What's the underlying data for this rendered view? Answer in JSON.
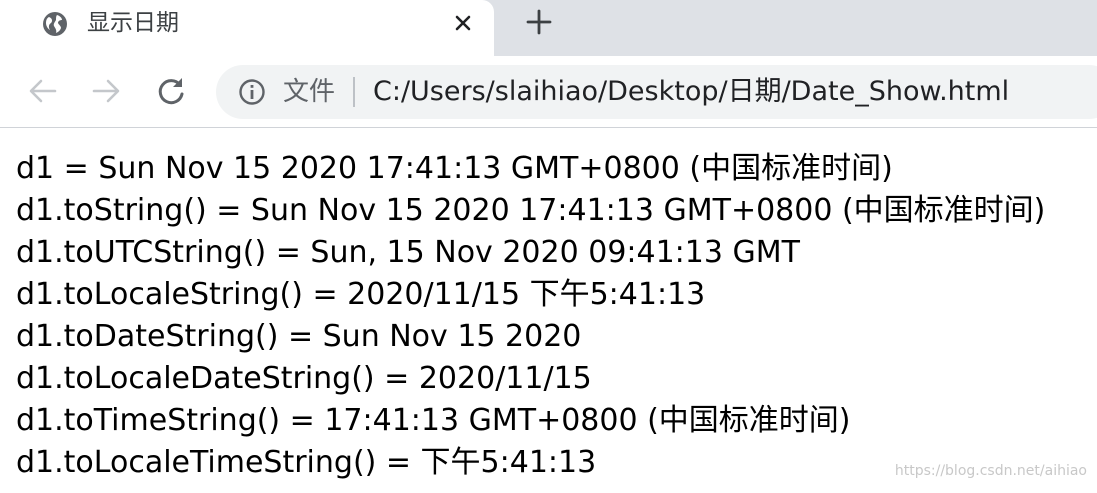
{
  "tab": {
    "title": "显示日期"
  },
  "toolbar": {
    "scheme_label": "文件",
    "url": "C:/Users/slaihiao/Desktop/日期/Date_Show.html"
  },
  "content": {
    "lines": [
      "d1 = Sun Nov 15 2020 17:41:13 GMT+0800 (中国标准时间)",
      "d1.toString() = Sun Nov 15 2020 17:41:13 GMT+0800 (中国标准时间)",
      "d1.toUTCString() = Sun, 15 Nov 2020 09:41:13 GMT",
      "d1.toLocaleString() = 2020/11/15 下午5:41:13",
      "d1.toDateString() = Sun Nov 15 2020",
      "d1.toLocaleDateString() = 2020/11/15",
      "d1.toTimeString() = 17:41:13 GMT+0800 (中国标准时间)",
      "d1.toLocaleTimeString() = 下午5:41:13"
    ]
  },
  "watermark": "https://blog.csdn.net/aihiao",
  "icons": {
    "favicon": "globe-icon",
    "close": "close-icon",
    "new_tab": "plus-icon",
    "back": "arrow-left-icon",
    "forward": "arrow-right-icon",
    "reload": "reload-icon",
    "info": "info-icon"
  },
  "colors": {
    "tabstrip": "#dee1e6",
    "omnibox": "#f1f3f4",
    "icon_disabled": "#c4c7cb",
    "icon_active": "#5f6368"
  }
}
